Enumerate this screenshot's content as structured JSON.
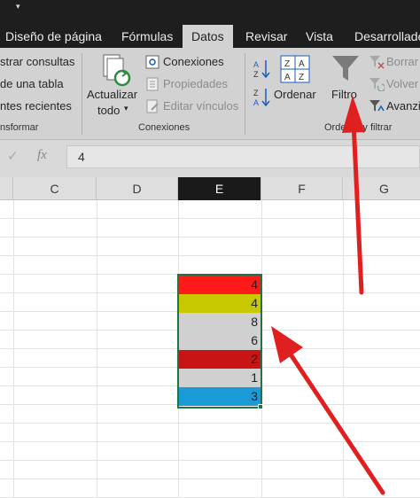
{
  "tabs": [
    "Diseño de página",
    "Fórmulas",
    "Datos",
    "Revisar",
    "Vista",
    "Desarrollado"
  ],
  "active_tab": "Datos",
  "ribbon": {
    "get_transform": {
      "items": [
        "strar consultas",
        "de una tabla",
        "ntes recientes"
      ],
      "group_label": "nsformar"
    },
    "connections": {
      "refresh_all_line1": "Actualizar",
      "refresh_all_line2": "todo",
      "connections": "Conexiones",
      "properties": "Propiedades",
      "edit_links": "Editar vínculos",
      "group_label": "Conexiones"
    },
    "sort_filter": {
      "sort": "Ordenar",
      "filter": "Filtro",
      "clear": "Borrar",
      "reapply": "Volver",
      "advanced": "Avanzi",
      "group_label": "Ordenar y filtrar"
    }
  },
  "formula_bar": {
    "value": "4",
    "fx": "fx"
  },
  "columns": [
    "C",
    "D",
    "E",
    "F",
    "G"
  ],
  "selected_column": "E",
  "cells": [
    {
      "value": "4",
      "color": "#ff1a1a"
    },
    {
      "value": "4",
      "color": "#c8c800"
    },
    {
      "value": "8",
      "color": "#d0d0d0"
    },
    {
      "value": "6",
      "color": "#d0d0d0"
    },
    {
      "value": "2",
      "color": "#c81414"
    },
    {
      "value": "1",
      "color": "#d0d0d0"
    },
    {
      "value": "3",
      "color": "#1a9bd7"
    }
  ],
  "colors": {
    "selection": "#217346",
    "annotation_arrow": "#e02020"
  }
}
